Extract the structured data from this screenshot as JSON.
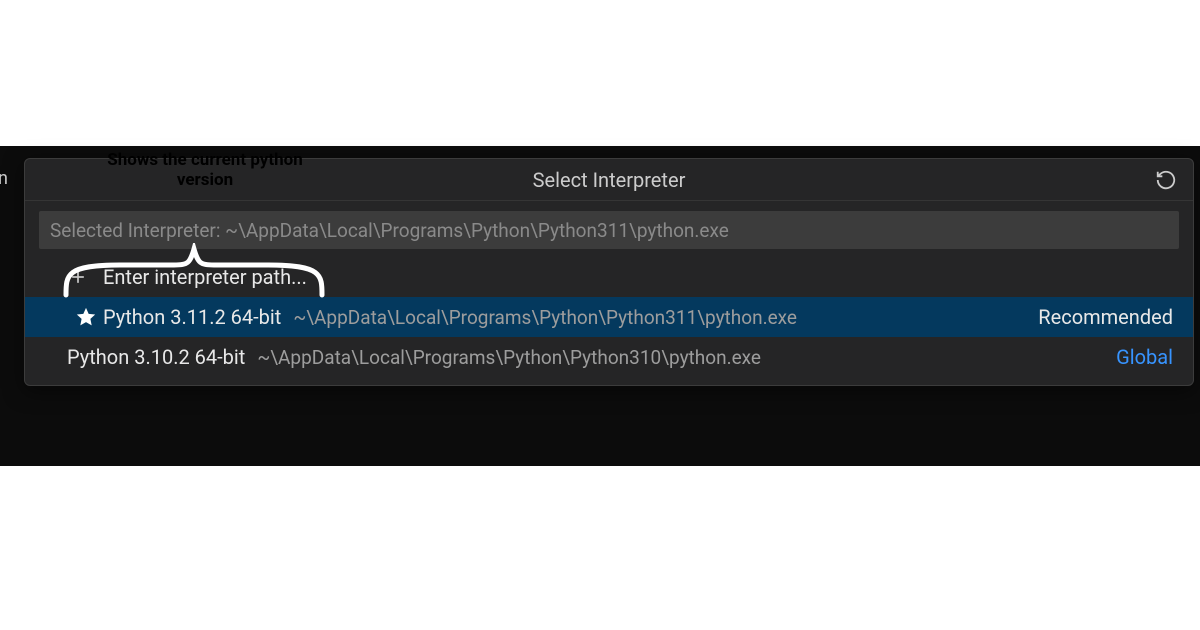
{
  "annotation": {
    "label": "Shows the current python version"
  },
  "palette": {
    "title": "Select Interpreter",
    "search_placeholder": "Selected Interpreter: ~\\AppData\\Local\\Programs\\Python\\Python311\\python.exe"
  },
  "items": {
    "enter_path": {
      "label": "Enter interpreter path..."
    },
    "py311": {
      "label": "Python 3.11.2 64-bit",
      "path": "~\\AppData\\Local\\Programs\\Python\\Python311\\python.exe",
      "badge": "Recommended"
    },
    "py310": {
      "label": "Python 3.10.2 64-bit",
      "path": "~\\AppData\\Local\\Programs\\Python\\Python310\\python.exe",
      "badge": "Global"
    }
  },
  "edge_fragment": "n"
}
